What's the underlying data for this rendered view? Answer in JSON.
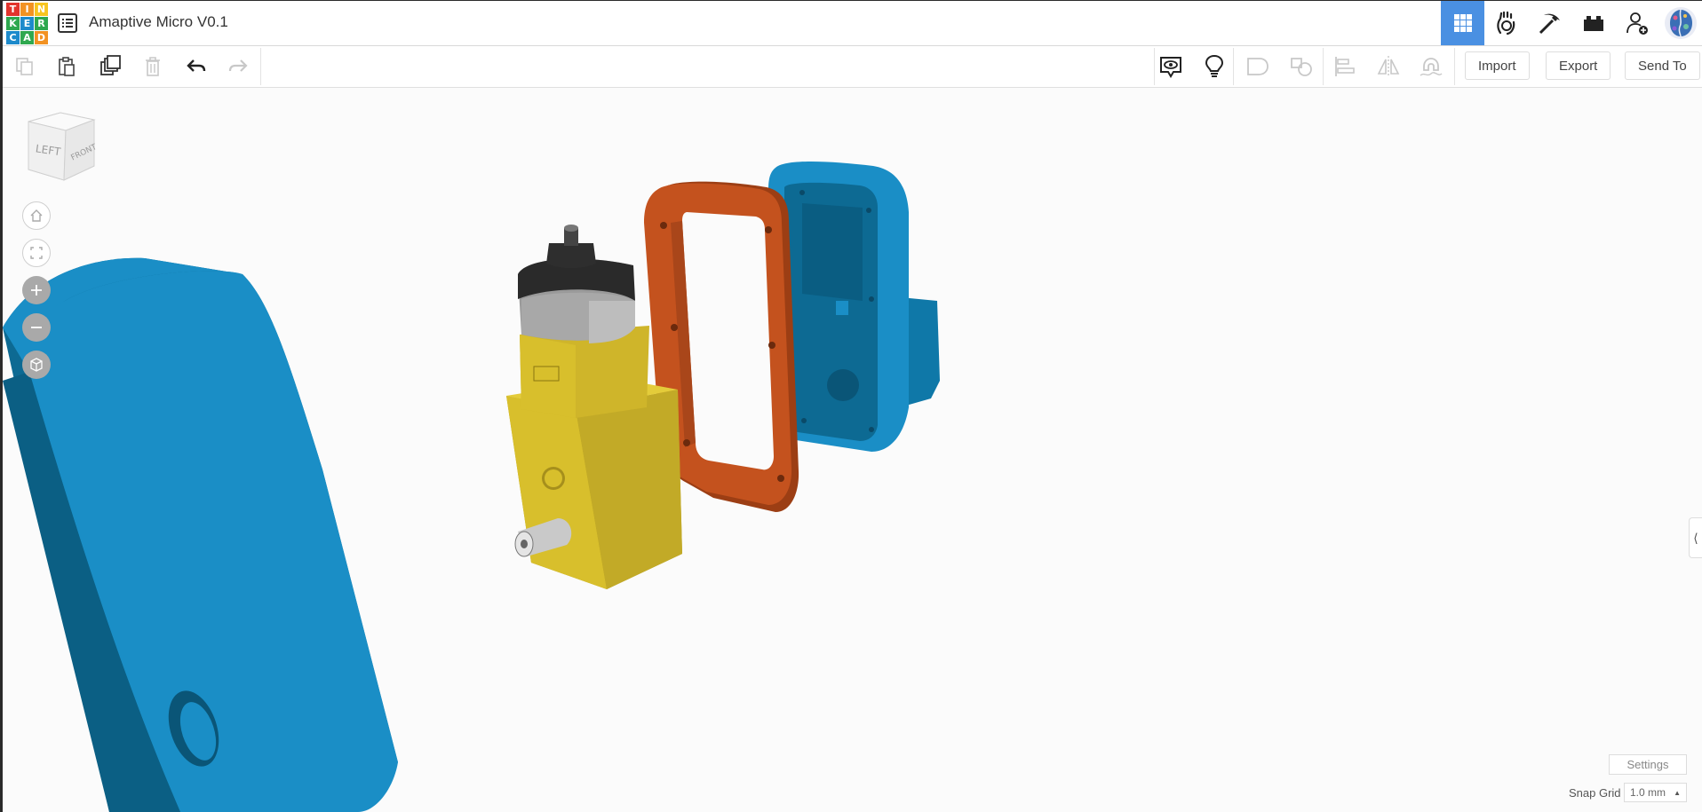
{
  "app": {
    "title": "Amaptive Micro V0.1",
    "logo_letters": [
      "T",
      "I",
      "N",
      "K",
      "E",
      "R",
      "C",
      "A",
      "D"
    ],
    "logo_colors": [
      "#e2342d",
      "#f29222",
      "#f7c520",
      "#2fa84f",
      "#1d8acb",
      "#2fa84f",
      "#1d8acb",
      "#2fa84f",
      "#f29222"
    ]
  },
  "topbar": {
    "icons": [
      "grid-view-icon",
      "hand-sim-icon",
      "pickaxe-icon",
      "brick-icon",
      "add-user-icon",
      "profile-avatar"
    ],
    "active": "grid-view-icon",
    "accent": "#4a90e2"
  },
  "toolbar": {
    "edit_icons": [
      "copy-icon",
      "paste-icon",
      "duplicate-icon",
      "delete-icon",
      "undo-icon",
      "redo-icon"
    ],
    "view_icons": [
      "notes-visibility-icon",
      "hint-lightbulb-icon",
      "group-icon",
      "ungroup-icon",
      "align-icon",
      "mirror-icon",
      "cruise-magnet-icon"
    ],
    "import_label": "Import",
    "export_label": "Export",
    "send_to_label": "Send To"
  },
  "viewcube": {
    "left_label": "LEFT",
    "front_label": "FRONT"
  },
  "nav": [
    "home-view-icon",
    "fit-view-icon",
    "zoom-in-icon",
    "zoom-out-icon",
    "perspective-icon"
  ],
  "footer": {
    "settings_label": "Settings",
    "snap_grid_label": "Snap Grid",
    "snap_grid_value": "1.0 mm"
  },
  "colors": {
    "blue_part": "#1a8ec6",
    "orange_part": "#c4521e",
    "yellow_part": "#d8bf2c",
    "motor_grey": "#9a9a9a"
  }
}
